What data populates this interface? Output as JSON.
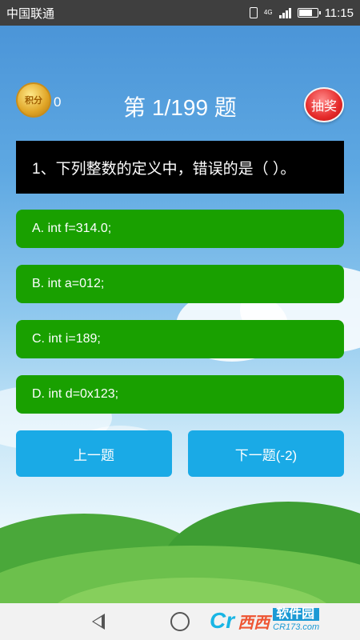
{
  "status_bar": {
    "carrier": "中国联通",
    "network": "4G",
    "time": "11:15"
  },
  "header": {
    "coin_label": "积分",
    "score": "0",
    "title": "第 1/199 题",
    "lottery_button": "抽奖"
  },
  "question": {
    "text": "1、下列整数的定义中，错误的是（   ）。"
  },
  "options": [
    {
      "label": "A. int f=314.0;"
    },
    {
      "label": "B. int a=012;"
    },
    {
      "label": "C. int i=189;"
    },
    {
      "label": "D. int d=0x123;"
    }
  ],
  "navigation": {
    "prev_label": "上一题",
    "next_label": "下一题(-2)"
  },
  "watermark": {
    "logo": "Cr",
    "brand": "西西",
    "name": "软件园",
    "url": "CR173.com"
  },
  "colors": {
    "option_green": "#19a000",
    "nav_blue": "#1aaae6",
    "question_bg": "#000000"
  }
}
